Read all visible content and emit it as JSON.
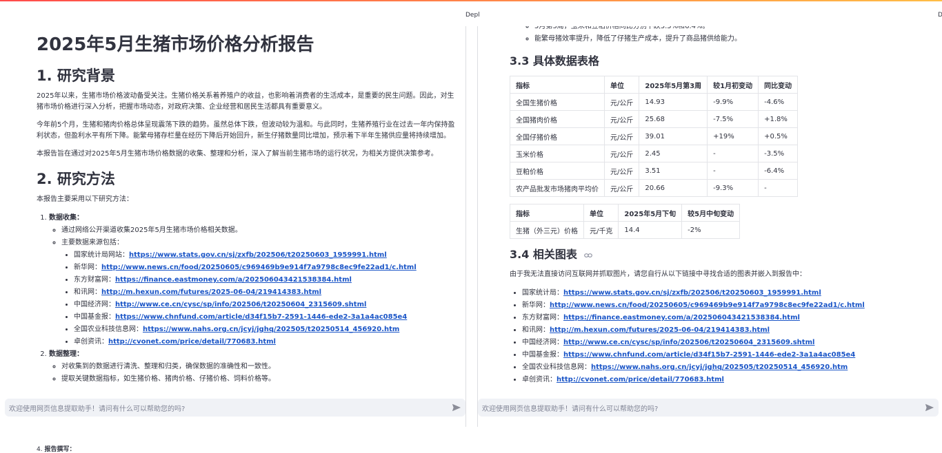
{
  "topbar": {
    "deploy_left": "Depl",
    "deploy_right": "D"
  },
  "left": {
    "title": "2025年5月生猪市场价格分析报告",
    "sec1_title": "1. 研究背景",
    "sec1_p1": "2025年以来，生猪市场价格波动备受关注。生猪价格关系着养殖户的收益，也影响着消费者的生活成本，是重要的民生问题。因此，对生猪市场价格进行深入分析，把握市场动态，对政府决策、企业经营和居民生活都具有重要意义。",
    "sec1_p2": "今年前5个月，生猪和猪肉价格总体呈现震荡下跌的趋势。虽然总体下跌，但波动较为温和。与此同时，生猪养殖行业在过去一年内保持盈利状态，但盈利水平有所下降。能繁母猪存栏量在经历下降后开始回升，新生仔猪数量同比增加，预示着下半年生猪供应量将持续增加。",
    "sec1_p3": "本报告旨在通过对2025年5月生猪市场价格数据的收集、整理和分析，深入了解当前生猪市场的运行状况，为相关方提供决策参考。",
    "sec2_title": "2. 研究方法",
    "sec2_intro": "本报告主要采用以下研究方法：",
    "item1_title": "数据收集：",
    "item1_sub1": "通过网络公开渠道收集2025年5月生猪市场价格相关数据。",
    "item1_sub2": "主要数据来源包括：",
    "sources": [
      {
        "label": "国家统计局网站：",
        "url": "https://www.stats.gov.cn/sj/zxfb/202506/t20250603_1959991.html"
      },
      {
        "label": "新华网：",
        "url": "http://www.news.cn/food/20250605/c969469b9e914f7a9798c8ec9fe22ad1/c.html"
      },
      {
        "label": "东方财富网：",
        "url": "https://finance.eastmoney.com/a/202506043421538384.html"
      },
      {
        "label": "和讯网：",
        "url": "http://m.hexun.com/futures/2025-06-04/219414383.html"
      },
      {
        "label": "中国经济网：",
        "url": "http://www.ce.cn/cysc/sp/info/202506/t20250604_2315609.shtml"
      },
      {
        "label": "中国基金报：",
        "url": "https://www.chnfund.com/article/d34f15b7-2591-1446-ede2-3a1a4ac085e4"
      },
      {
        "label": "全国农业科技信息网：",
        "url": "https://www.nahs.org.cn/jcyj/jghq/202505/t20250514_456920.htm"
      },
      {
        "label": "卓创资讯：",
        "url": "http://cvonet.com/price/detail/770683.html"
      }
    ],
    "item2_title": "数据整理：",
    "item2_sub1": "对收集到的数据进行清洗、整理和归类，确保数据的准确性和一致性。",
    "item2_sub2": "提取关键数据指标，如生猪价格、猪肉价格、仔猪价格、饲料价格等。",
    "item4_partial": "报告撰写："
  },
  "right": {
    "bullet_a": "5月第3周，玉米和豆粕价格同比分别下跌3.5%和6.4%。",
    "bullet_b": "能繁母猪效率提升，降低了仔猪生产成本，提升了商品猪供给能力。",
    "sec33_title": "3.3 具体数据表格",
    "table1": {
      "headers": [
        "指标",
        "单位",
        "2025年5月第3周",
        "较1月初变动",
        "同比变动"
      ],
      "rows": [
        [
          "全国生猪价格",
          "元/公斤",
          "14.93",
          "-9.9%",
          "-4.6%"
        ],
        [
          "全国猪肉价格",
          "元/公斤",
          "25.68",
          "-7.5%",
          "+1.8%"
        ],
        [
          "全国仔猪价格",
          "元/公斤",
          "39.01",
          "+19%",
          "+0.5%"
        ],
        [
          "玉米价格",
          "元/公斤",
          "2.45",
          "-",
          "-3.5%"
        ],
        [
          "豆粕价格",
          "元/公斤",
          "3.51",
          "-",
          "-6.4%"
        ],
        [
          "农产品批发市场猪肉平均价",
          "元/公斤",
          "20.66",
          "-9.3%",
          "-"
        ]
      ]
    },
    "table2": {
      "headers": [
        "指标",
        "单位",
        "2025年5月下旬",
        "较5月中旬变动"
      ],
      "rows": [
        [
          "生猪（外三元）价格",
          "元/千克",
          "14.4",
          "-2%"
        ]
      ]
    },
    "sec34_title": "3.4 相关图表",
    "sec34_intro": "由于我无法直接访问互联网并抓取图片，请您自行从以下链接中寻找合适的图表并嵌入到报告中：",
    "links": [
      {
        "label": "国家统计局：",
        "url": "https://www.stats.gov.cn/sj/zxfb/202506/t20250603_1959991.html"
      },
      {
        "label": "新华网：",
        "url": "http://www.news.cn/food/20250605/c969469b9e914f7a9798c8ec9fe22ad1/c.html"
      },
      {
        "label": "东方财富网：",
        "url": "https://finance.eastmoney.com/a/202506043421538384.html"
      },
      {
        "label": "和讯网：",
        "url": "http://m.hexun.com/futures/2025-06-04/219414383.html"
      },
      {
        "label": "中国经济网：",
        "url": "http://www.ce.cn/cysc/sp/info/202506/t20250604_2315609.shtml"
      },
      {
        "label": "中国基金报：",
        "url": "https://www.chnfund.com/article/d34f15b7-2591-1446-ede2-3a1a4ac085e4"
      },
      {
        "label": "全国农业科技信息网：",
        "url": "https://www.nahs.org.cn/jcyj/jghq/202505/t20250514_456920.htm"
      },
      {
        "label": "卓创资讯：",
        "url": "http://cvonet.com/price/detail/770683.html"
      }
    ]
  },
  "chat": {
    "placeholder_left": "欢迎使用网页信息提取助手！请问有什么可以帮助您的吗?",
    "placeholder_right": "欢迎使用网页信息提取助手！请问有什么可以帮助您的吗?"
  },
  "colors": {
    "accent_start": "#ff4b4b",
    "accent_end": "#ffbd45",
    "link": "#1a55c7",
    "chat_bg": "#f0f2f6"
  },
  "icons": [
    "link-icon",
    "send-icon"
  ]
}
